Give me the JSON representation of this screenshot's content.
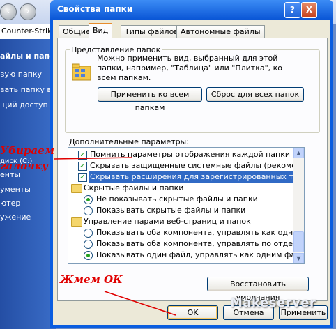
{
  "background_window": {
    "address_text": "Counter-Strike",
    "sidebar_header": "айлы и папок",
    "sidebar_items": [
      "вую папку",
      "вать папку в ве",
      "щий доступ к",
      "диск (C:)",
      "енты",
      "ументы",
      "ютер",
      "ужение"
    ]
  },
  "annotations": {
    "remove_tick_line1": "Убираем",
    "remove_tick_line2": "галочку",
    "press_ok": "Жмем ОК"
  },
  "dialog": {
    "title": "Свойства папки",
    "help_glyph": "?",
    "close_glyph": "X",
    "tabs": [
      "Общие",
      "Вид",
      "Типы файлов",
      "Автономные файлы"
    ],
    "active_tab": "Вид",
    "folder_views": {
      "legend": "Представление папок",
      "description": "Можно применить вид, выбранный для этой папки, например, \"Таблица\" или \"Плитка\", ко всем папкам.",
      "apply_all_button": "Применить ко всем папкам",
      "reset_all_button": "Сброс для всех папок"
    },
    "advanced_label": "Дополнительные параметры:",
    "advanced_items": [
      {
        "kind": "checkbox",
        "checked": true,
        "label": "Помнить параметры отображения каждой папки"
      },
      {
        "kind": "checkbox",
        "checked": true,
        "label": "Скрывать защищенные системные файлы (рекомендуется)"
      },
      {
        "kind": "checkbox",
        "checked": true,
        "selected": true,
        "label": "Скрывать расширения для зарегистрированных типов файлов"
      },
      {
        "kind": "folder",
        "label": "Скрытые файлы и папки"
      },
      {
        "kind": "radio",
        "checked": true,
        "label": "Не показывать скрытые файлы и папки"
      },
      {
        "kind": "radio",
        "checked": false,
        "label": "Показывать скрытые файлы и папки"
      },
      {
        "kind": "folder",
        "label": "Управление парами веб-страниц и папок"
      },
      {
        "kind": "radio",
        "checked": false,
        "label": "Показывать оба компонента, управлять как одним файлом"
      },
      {
        "kind": "radio",
        "checked": false,
        "label": "Показывать оба компонента, управлять по отдельности"
      },
      {
        "kind": "radio",
        "checked": true,
        "label": "Показывать один файл, управлять как одним файлом"
      }
    ],
    "restore_defaults_button": "Восстановить умолчания",
    "ok_button": "OK",
    "cancel_button": "Отмена",
    "apply_button": "Применить"
  },
  "watermark": "Makeserver",
  "colors": {
    "title_bar": "#0a56d6",
    "selection": "#316ac5",
    "annotation": "#e00000",
    "tab_highlight": "#e68b2c"
  }
}
